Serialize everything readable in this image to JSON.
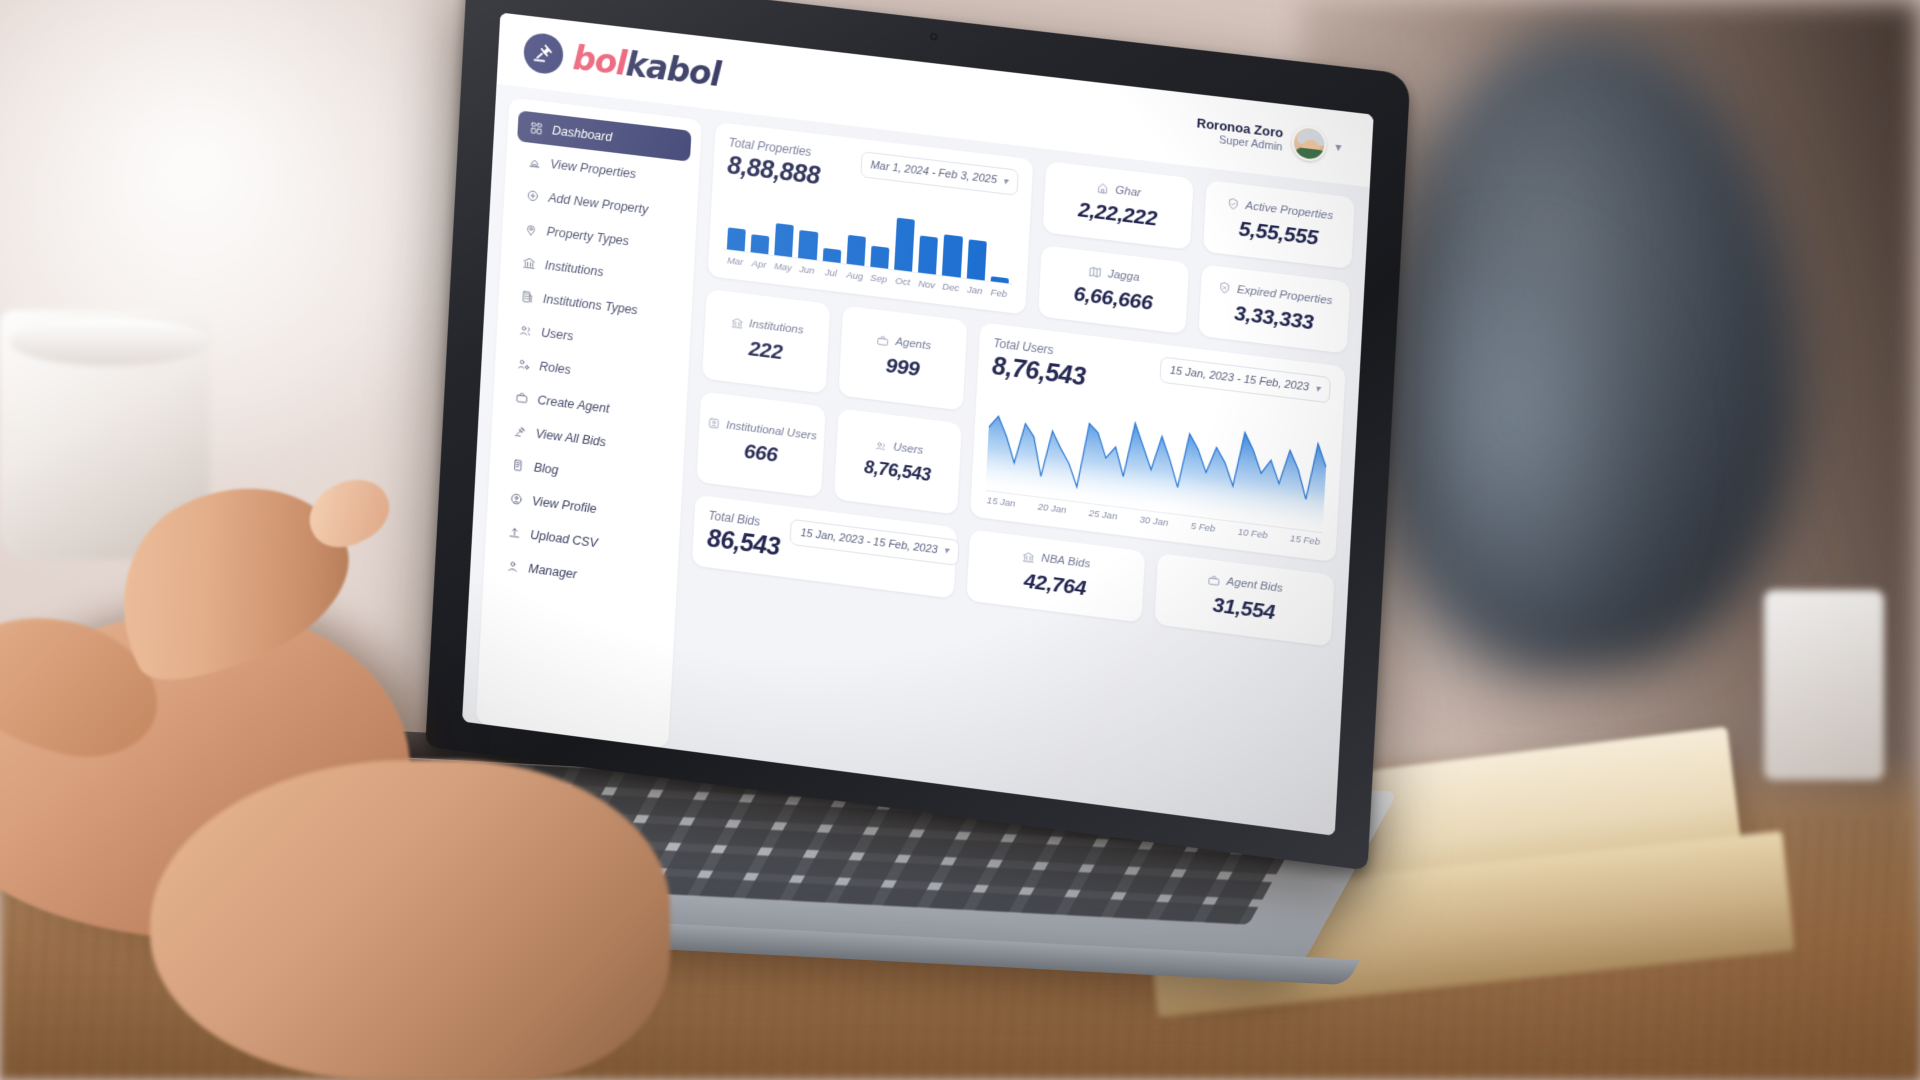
{
  "brand": {
    "part1": "bol",
    "part2": "kabol",
    "mark_icon": "auction-gavel-icon"
  },
  "user": {
    "name": "Roronoa Zoro",
    "role": "Super Admin",
    "avatar_icon": "user-avatar",
    "chevron_icon": "chevron-down-icon"
  },
  "sidebar": {
    "items": [
      {
        "label": "Dashboard",
        "icon": "grid-dashboard-icon",
        "active": true
      },
      {
        "label": "View Properties",
        "icon": "properties-icon",
        "active": false
      },
      {
        "label": "Add New Property",
        "icon": "plus-circle-icon",
        "active": false
      },
      {
        "label": "Property Types",
        "icon": "tag-location-icon",
        "active": false
      },
      {
        "label": "Institutions",
        "icon": "bank-icon",
        "active": false
      },
      {
        "label": "Institutions Types",
        "icon": "building-icon",
        "active": false
      },
      {
        "label": "Users",
        "icon": "users-icon",
        "active": false
      },
      {
        "label": "Roles",
        "icon": "user-gear-icon",
        "active": false
      },
      {
        "label": "Create Agent",
        "icon": "briefcase-icon",
        "active": false
      },
      {
        "label": "View All Bids",
        "icon": "gavel-icon",
        "active": false
      },
      {
        "label": "Blog",
        "icon": "article-icon",
        "active": false
      },
      {
        "label": "View Profile",
        "icon": "user-circle-icon",
        "active": false
      },
      {
        "label": "Upload CSV",
        "icon": "upload-icon",
        "active": false
      },
      {
        "label": "Manager",
        "icon": "manager-icon",
        "active": false
      }
    ]
  },
  "total_properties": {
    "title": "Total Properties",
    "value": "8,88,888",
    "date_range": "Mar 1, 2024  -  Feb 3, 2025",
    "chevron_icon": "chevron-down-icon"
  },
  "stats": {
    "ghar": {
      "label": "Ghar",
      "value": "2,22,222",
      "icon": "house-icon"
    },
    "active_properties": {
      "label": "Active Properties",
      "value": "5,55,555",
      "icon": "shield-check-icon"
    },
    "jagga": {
      "label": "Jagga",
      "value": "6,66,666",
      "icon": "map-icon"
    },
    "expired_properties": {
      "label": "Expired Properties",
      "value": "3,33,333",
      "icon": "shield-x-icon"
    },
    "institutions": {
      "label": "Institutions",
      "value": "222",
      "icon": "bank-icon"
    },
    "agents": {
      "label": "Agents",
      "value": "999",
      "icon": "briefcase-icon"
    },
    "institutional_users": {
      "label": "Institutional Users",
      "value": "666",
      "icon": "user-square-icon"
    },
    "users": {
      "label": "Users",
      "value": "8,76,543",
      "icon": "users-icon"
    },
    "nba_bids": {
      "label": "NBA Bids",
      "value": "42,764",
      "icon": "bank-icon"
    },
    "agent_bids": {
      "label": "Agent Bids",
      "value": "31,554",
      "icon": "briefcase-icon"
    }
  },
  "total_users": {
    "title": "Total Users",
    "value": "8,76,543",
    "date_range": "15 Jan, 2023  -  15 Feb, 2023",
    "chevron_icon": "chevron-down-icon"
  },
  "total_bids": {
    "title": "Total Bids",
    "value": "86,543",
    "date_range": "15 Jan, 2023  -  15 Feb, 2023",
    "chevron_icon": "chevron-down-icon"
  },
  "colors": {
    "brand_red": "#e8415c",
    "brand_navy": "#191c4c",
    "sidebar_active": "#272c63",
    "bar_blue": "#1168cf",
    "area_blue": "#2b7fdd",
    "text_muted": "#6d7291"
  },
  "chart_data": [
    {
      "type": "bar",
      "title": "Total Properties",
      "xlabel": "",
      "ylabel": "",
      "categories": [
        "Mar",
        "Apr",
        "May",
        "Jun",
        "Jul",
        "Aug",
        "Sep",
        "Oct",
        "Nov",
        "Dec",
        "Jan",
        "Feb"
      ],
      "values": [
        38,
        30,
        55,
        48,
        22,
        50,
        35,
        88,
        62,
        70,
        66,
        8
      ],
      "ylim": [
        0,
        100
      ],
      "grid": false,
      "legend": "none",
      "series_color": "#1168cf"
    },
    {
      "type": "area",
      "title": "Total Users",
      "xlabel": "",
      "ylabel": "",
      "x": [
        "15 Jan",
        "20 Jan",
        "25 Jan",
        "30 Jan",
        "5 Feb",
        "10 Feb",
        "15 Feb"
      ],
      "tick_positions": [
        0,
        16.6,
        33.3,
        50,
        66.6,
        83.3,
        100
      ],
      "values": [
        62,
        74,
        55,
        30,
        70,
        58,
        20,
        66,
        50,
        36,
        14,
        78,
        70,
        46,
        58,
        30,
        84,
        62,
        40,
        74,
        52,
        26,
        80,
        66,
        44,
        70,
        56,
        34,
        88,
        72,
        50,
        64,
        42,
        76,
        58,
        30,
        86,
        64
      ],
      "ylim": [
        0,
        100
      ],
      "grid": false,
      "legend": "none",
      "series_color": "#2b7fdd"
    }
  ]
}
